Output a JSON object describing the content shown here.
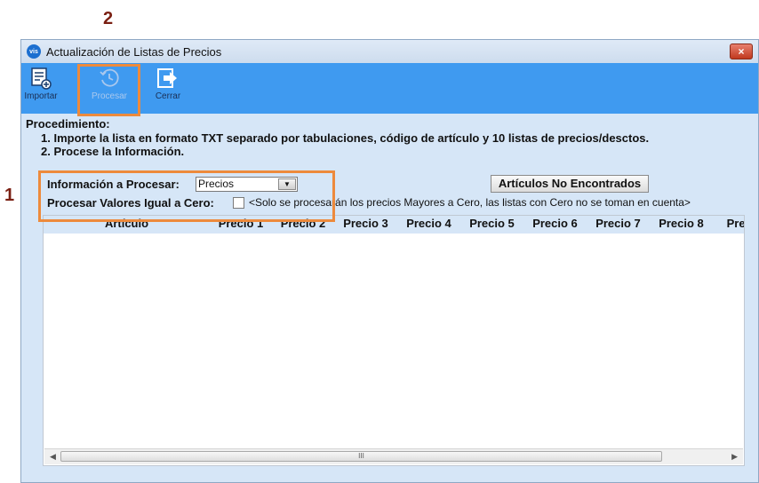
{
  "callouts": {
    "one": "1",
    "two": "2"
  },
  "window": {
    "title": "Actualización de Listas de Precios",
    "close_icon": "close-icon",
    "close_glyph": "×",
    "app_badge": "vis"
  },
  "toolbar": {
    "importar_label": "Importar",
    "procesar_label": "Procesar",
    "cerrar_label": "Cerrar",
    "procesar_disabled": true,
    "accent": "#3f9af0"
  },
  "procedure": {
    "title": "Procedimiento:",
    "step1": "1. Importe la lista en formato TXT separado por tabulaciones, código de artículo y 10 listas de precios/desctos.",
    "step2": "2. Procese la Información."
  },
  "form": {
    "info_label": "Información a Procesar:",
    "info_value": "Precios",
    "zero_label": "Procesar Valores Igual a Cero:",
    "zero_checked": false,
    "zero_note": "<Solo se procesarán los precios Mayores a Cero, las listas con Cero no se toman en cuenta>",
    "not_found_button": "Artículos No Encontrados"
  },
  "grid": {
    "columns": [
      "Artículo",
      "Precio 1",
      "Precio 2",
      "Precio 3",
      "Precio 4",
      "Precio 5",
      "Precio 6",
      "Precio 7",
      "Precio 8",
      "Precio"
    ],
    "scroll_thumb_glyph": "III"
  },
  "colors": {
    "highlight": "#ed8a3c",
    "window_bg": "#d6e6f7",
    "callout": "#7a1f12"
  }
}
